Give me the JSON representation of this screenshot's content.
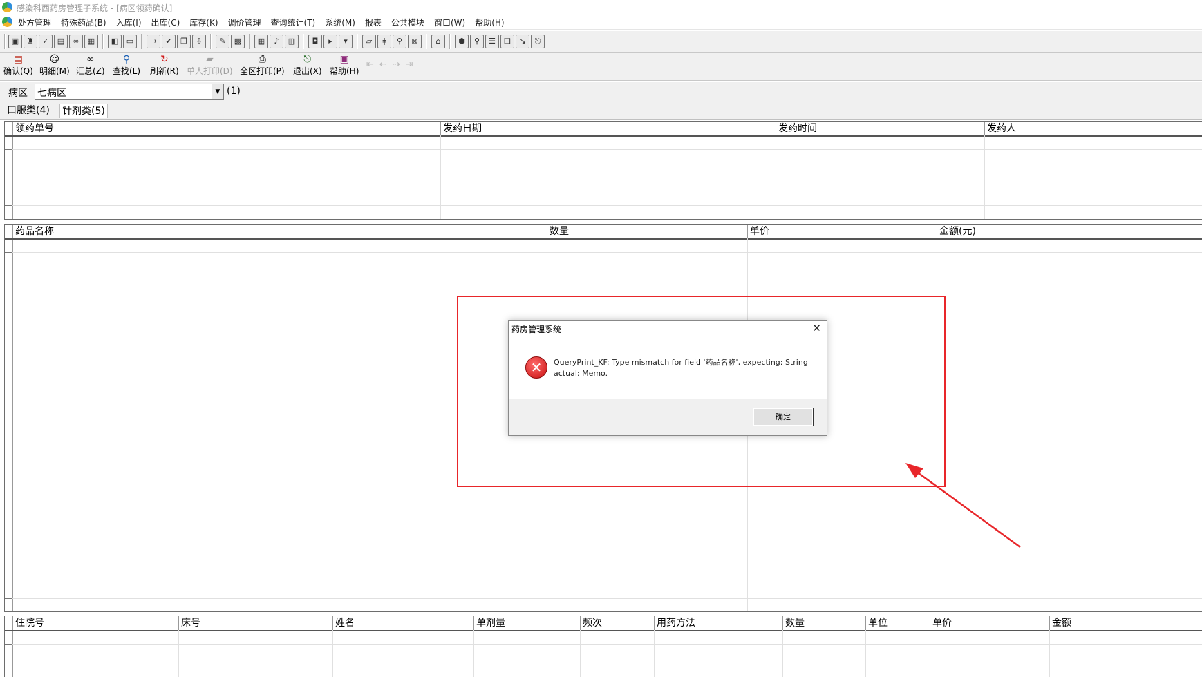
{
  "window": {
    "title": "感染科西药房管理子系统 - [病区领药确认]"
  },
  "menu": {
    "items": [
      "处方管理",
      "特殊药品(B)",
      "入库(I)",
      "出库(C)",
      "库存(K)",
      "调价管理",
      "查询统计(T)",
      "系统(M)",
      "报表",
      "公共模块",
      "窗口(W)",
      "帮助(H)"
    ]
  },
  "toolbar2": {
    "buttons": [
      {
        "label": "确认(Q)",
        "icon": "document-check-icon"
      },
      {
        "label": "明细(M)",
        "icon": "person-icon"
      },
      {
        "label": "汇总(Z)",
        "icon": "binoculars-icon"
      },
      {
        "label": "查找(L)",
        "icon": "magnifier-icon"
      },
      {
        "label": "刷新(R)",
        "icon": "refresh-icon"
      },
      {
        "label": "单人打印(D)",
        "icon": "print-single-icon"
      },
      {
        "label": "全区打印(P)",
        "icon": "printer-icon"
      },
      {
        "label": "退出(X)",
        "icon": "exit-icon"
      },
      {
        "label": "帮助(H)",
        "icon": "help-book-icon"
      }
    ]
  },
  "ward": {
    "label": "病区",
    "value": "七病区",
    "count": "(1)"
  },
  "tabs": [
    {
      "label": "口服类(4)",
      "active": false
    },
    {
      "label": "针剂类(5)",
      "active": true
    }
  ],
  "grid_orders": {
    "columns": [
      "领药单号",
      "发药日期",
      "发药时间",
      "发药人"
    ]
  },
  "grid_drugs": {
    "columns": [
      "药品名称",
      "数量",
      "单价",
      "金额(元)"
    ]
  },
  "grid_patients": {
    "columns": [
      "住院号",
      "床号",
      "姓名",
      "单剂量",
      "频次",
      "用药方法",
      "数量",
      "单位",
      "单价",
      "金额"
    ]
  },
  "dialog": {
    "title": "药房管理系统",
    "message": "QueryPrint_KF: Type mismatch for field '药品名称', expecting: String actual: Memo.",
    "ok_label": "确定"
  },
  "colors": {
    "annotation": "#e8262a"
  }
}
